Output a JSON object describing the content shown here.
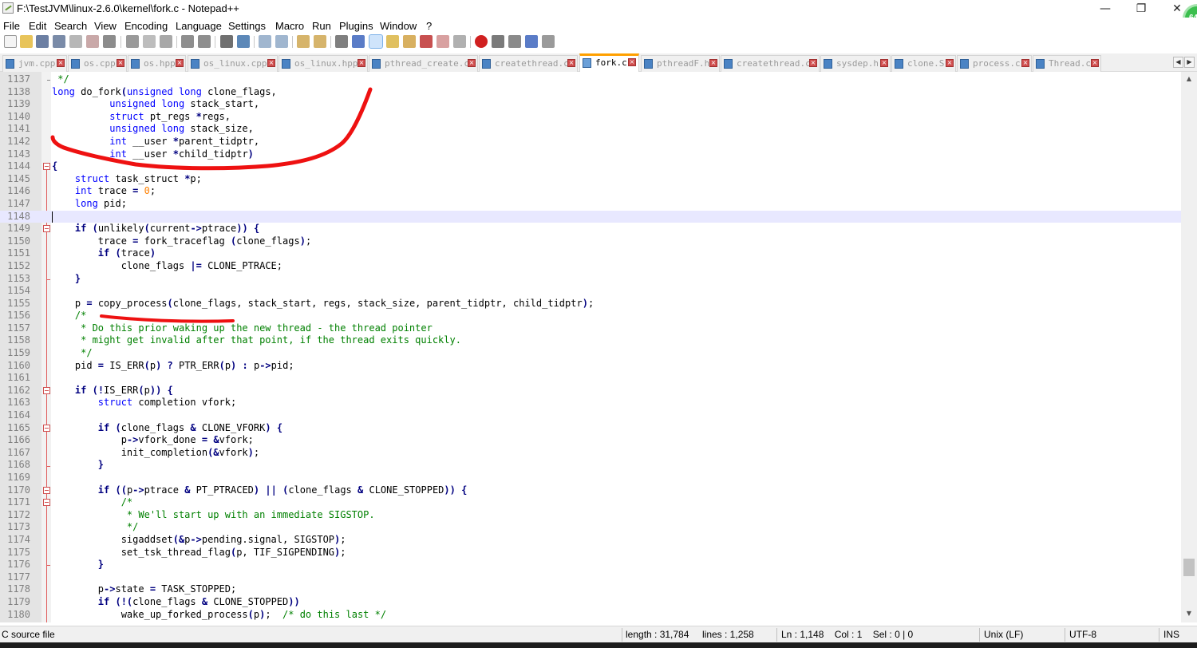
{
  "window": {
    "title": "F:\\TestJVM\\linux-2.6.0\\kernel\\fork.c - Notepad++",
    "minimize": "—",
    "maximize": "❐",
    "close": "✕",
    "badge": "64"
  },
  "menu": [
    "File",
    "Edit",
    "Search",
    "View",
    "Encoding",
    "Language",
    "Settings",
    "Macro",
    "Run",
    "Plugins",
    "Window",
    "?"
  ],
  "tabs": [
    {
      "label": "jvm.cpp",
      "active": false
    },
    {
      "label": "os.cpp",
      "active": false
    },
    {
      "label": "os.hpp",
      "active": false
    },
    {
      "label": "os_linux.cpp",
      "active": false
    },
    {
      "label": "os_linux.hpp",
      "active": false
    },
    {
      "label": "pthread_create.c",
      "active": false
    },
    {
      "label": "createthread.c",
      "active": false
    },
    {
      "label": "fork.c",
      "active": true
    },
    {
      "label": "pthreadF.h",
      "active": false
    },
    {
      "label": "createthread.c",
      "active": false
    },
    {
      "label": "sysdep.h",
      "active": false
    },
    {
      "label": "clone.S",
      "active": false
    },
    {
      "label": "process.c",
      "active": false
    },
    {
      "label": "Thread.c",
      "active": false
    }
  ],
  "editor": {
    "line_numbers": [
      "1137",
      "1138",
      "1139",
      "1140",
      "1141",
      "1142",
      "1143",
      "1144",
      "1145",
      "1146",
      "1147",
      "1148",
      "1149",
      "1150",
      "1151",
      "1152",
      "1153",
      "1154",
      "1155",
      "1156",
      "1157",
      "1158",
      "1159",
      "1160",
      "1161",
      "1162",
      "1163",
      "1164",
      "1165",
      "1166",
      "1167",
      "1168",
      "1169",
      "1170",
      "1171",
      "1172",
      "1173",
      "1174",
      "1175",
      "1176",
      "1177",
      "1178",
      "1179",
      "1180"
    ],
    "current_line": "1148",
    "code": [
      [
        [
          "cm",
          " */"
        ]
      ],
      [
        [
          "kw",
          "long"
        ],
        [
          "",
          " do_fork"
        ],
        [
          "op",
          "("
        ],
        [
          "kw",
          "unsigned long"
        ],
        [
          "",
          " clone_flags,"
        ]
      ],
      [
        [
          "",
          "          "
        ],
        [
          "kw",
          "unsigned long"
        ],
        [
          "",
          " stack_start,"
        ]
      ],
      [
        [
          "",
          "          "
        ],
        [
          "kw",
          "struct"
        ],
        [
          "",
          " pt_regs "
        ],
        [
          "op",
          "*"
        ],
        [
          "",
          "regs,"
        ]
      ],
      [
        [
          "",
          "          "
        ],
        [
          "kw",
          "unsigned long"
        ],
        [
          "",
          " stack_size,"
        ]
      ],
      [
        [
          "",
          "          "
        ],
        [
          "kw",
          "int"
        ],
        [
          "",
          " __user "
        ],
        [
          "op",
          "*"
        ],
        [
          "",
          "parent_tidptr,"
        ]
      ],
      [
        [
          "",
          "          "
        ],
        [
          "kw",
          "int"
        ],
        [
          "",
          " __user "
        ],
        [
          "op",
          "*"
        ],
        [
          "",
          "child_tidptr"
        ],
        [
          "op",
          ")"
        ]
      ],
      [
        [
          "op",
          "{"
        ]
      ],
      [
        [
          "",
          "    "
        ],
        [
          "kw",
          "struct"
        ],
        [
          "",
          " task_struct "
        ],
        [
          "op",
          "*"
        ],
        [
          "",
          "p;"
        ]
      ],
      [
        [
          "",
          "    "
        ],
        [
          "kw",
          "int"
        ],
        [
          "",
          " trace "
        ],
        [
          "op",
          "="
        ],
        [
          "",
          " "
        ],
        [
          "num",
          "0"
        ],
        [
          "",
          ";"
        ]
      ],
      [
        [
          "",
          "    "
        ],
        [
          "kw",
          "long"
        ],
        [
          "",
          " pid;"
        ]
      ],
      [
        [
          "",
          ""
        ]
      ],
      [
        [
          "",
          "    "
        ],
        [
          "op",
          "if"
        ],
        [
          "",
          " "
        ],
        [
          "op",
          "("
        ],
        [
          "",
          "unlikely"
        ],
        [
          "op",
          "("
        ],
        [
          "",
          "current"
        ],
        [
          "op",
          "->"
        ],
        [
          "",
          "ptrace"
        ],
        [
          "op",
          "))"
        ],
        [
          "",
          " "
        ],
        [
          "op",
          "{"
        ]
      ],
      [
        [
          "",
          "        trace "
        ],
        [
          "op",
          "="
        ],
        [
          "",
          " fork_traceflag "
        ],
        [
          "op",
          "("
        ],
        [
          "",
          "clone_flags"
        ],
        [
          "op",
          ")"
        ],
        [
          "",
          ";"
        ]
      ],
      [
        [
          "",
          "        "
        ],
        [
          "op",
          "if"
        ],
        [
          "",
          " "
        ],
        [
          "op",
          "("
        ],
        [
          "",
          "trace"
        ],
        [
          "op",
          ")"
        ]
      ],
      [
        [
          "",
          "            clone_flags "
        ],
        [
          "op",
          "|="
        ],
        [
          "",
          " CLONE_PTRACE;"
        ]
      ],
      [
        [
          "",
          "    "
        ],
        [
          "op",
          "}"
        ]
      ],
      [
        [
          "",
          ""
        ]
      ],
      [
        [
          "",
          "    p "
        ],
        [
          "op",
          "="
        ],
        [
          "",
          " copy_process"
        ],
        [
          "op",
          "("
        ],
        [
          "",
          "clone_flags, stack_start, regs, stack_size, parent_tidptr, child_tidptr"
        ],
        [
          "op",
          ")"
        ],
        [
          "",
          ";"
        ]
      ],
      [
        [
          "",
          "    "
        ],
        [
          "cm",
          "/*"
        ]
      ],
      [
        [
          "cm",
          "     * Do this prior waking up the new thread - the thread pointer"
        ]
      ],
      [
        [
          "cm",
          "     * might get invalid after that point, if the thread exits quickly."
        ]
      ],
      [
        [
          "cm",
          "     */"
        ]
      ],
      [
        [
          "",
          "    pid "
        ],
        [
          "op",
          "="
        ],
        [
          "",
          " IS_ERR"
        ],
        [
          "op",
          "("
        ],
        [
          "",
          "p"
        ],
        [
          "op",
          ")"
        ],
        [
          "",
          " "
        ],
        [
          "op",
          "?"
        ],
        [
          "",
          " PTR_ERR"
        ],
        [
          "op",
          "("
        ],
        [
          "",
          "p"
        ],
        [
          "op",
          ")"
        ],
        [
          "",
          " "
        ],
        [
          "op",
          ":"
        ],
        [
          "",
          " p"
        ],
        [
          "op",
          "->"
        ],
        [
          "",
          "pid;"
        ]
      ],
      [
        [
          "",
          ""
        ]
      ],
      [
        [
          "",
          "    "
        ],
        [
          "op",
          "if"
        ],
        [
          "",
          " "
        ],
        [
          "op",
          "(!"
        ],
        [
          "",
          "IS_ERR"
        ],
        [
          "op",
          "("
        ],
        [
          "",
          "p"
        ],
        [
          "op",
          "))"
        ],
        [
          "",
          " "
        ],
        [
          "op",
          "{"
        ]
      ],
      [
        [
          "",
          "        "
        ],
        [
          "kw",
          "struct"
        ],
        [
          "",
          " completion vfork;"
        ]
      ],
      [
        [
          "",
          ""
        ]
      ],
      [
        [
          "",
          "        "
        ],
        [
          "op",
          "if"
        ],
        [
          "",
          " "
        ],
        [
          "op",
          "("
        ],
        [
          "",
          "clone_flags "
        ],
        [
          "op",
          "&"
        ],
        [
          "",
          " CLONE_VFORK"
        ],
        [
          "op",
          ")"
        ],
        [
          "",
          " "
        ],
        [
          "op",
          "{"
        ]
      ],
      [
        [
          "",
          "            p"
        ],
        [
          "op",
          "->"
        ],
        [
          "",
          "vfork_done "
        ],
        [
          "op",
          "="
        ],
        [
          "",
          " "
        ],
        [
          "op",
          "&"
        ],
        [
          "",
          "vfork;"
        ]
      ],
      [
        [
          "",
          "            init_completion"
        ],
        [
          "op",
          "(&"
        ],
        [
          "",
          "vfork"
        ],
        [
          "op",
          ")"
        ],
        [
          "",
          ";"
        ]
      ],
      [
        [
          "",
          "        "
        ],
        [
          "op",
          "}"
        ]
      ],
      [
        [
          "",
          ""
        ]
      ],
      [
        [
          "",
          "        "
        ],
        [
          "op",
          "if"
        ],
        [
          "",
          " "
        ],
        [
          "op",
          "(("
        ],
        [
          "",
          "p"
        ],
        [
          "op",
          "->"
        ],
        [
          "",
          "ptrace "
        ],
        [
          "op",
          "&"
        ],
        [
          "",
          " PT_PTRACED"
        ],
        [
          "op",
          ")"
        ],
        [
          "",
          " "
        ],
        [
          "op",
          "||"
        ],
        [
          "",
          " "
        ],
        [
          "op",
          "("
        ],
        [
          "",
          "clone_flags "
        ],
        [
          "op",
          "&"
        ],
        [
          "",
          " CLONE_STOPPED"
        ],
        [
          "op",
          "))"
        ],
        [
          "",
          " "
        ],
        [
          "op",
          "{"
        ]
      ],
      [
        [
          "",
          "            "
        ],
        [
          "cm",
          "/*"
        ]
      ],
      [
        [
          "cm",
          "             * We'll start up with an immediate SIGSTOP."
        ]
      ],
      [
        [
          "cm",
          "             */"
        ]
      ],
      [
        [
          "",
          "            sigaddset"
        ],
        [
          "op",
          "(&"
        ],
        [
          "",
          "p"
        ],
        [
          "op",
          "->"
        ],
        [
          "",
          "pending.signal, SIGSTOP"
        ],
        [
          "op",
          ")"
        ],
        [
          "",
          ";"
        ]
      ],
      [
        [
          "",
          "            set_tsk_thread_flag"
        ],
        [
          "op",
          "("
        ],
        [
          "",
          "p, TIF_SIGPENDING"
        ],
        [
          "op",
          ")"
        ],
        [
          "",
          ";"
        ]
      ],
      [
        [
          "",
          "        "
        ],
        [
          "op",
          "}"
        ]
      ],
      [
        [
          "",
          ""
        ]
      ],
      [
        [
          "",
          "        p"
        ],
        [
          "op",
          "->"
        ],
        [
          "",
          "state "
        ],
        [
          "op",
          "="
        ],
        [
          "",
          " TASK_STOPPED;"
        ]
      ],
      [
        [
          "",
          "        "
        ],
        [
          "op",
          "if"
        ],
        [
          "",
          " "
        ],
        [
          "op",
          "(!("
        ],
        [
          "",
          "clone_flags "
        ],
        [
          "op",
          "&"
        ],
        [
          "",
          " CLONE_STOPPED"
        ],
        [
          "op",
          "))"
        ]
      ],
      [
        [
          "",
          "            wake_up_forked_process"
        ],
        [
          "op",
          "("
        ],
        [
          "",
          "p"
        ],
        [
          "op",
          ")"
        ],
        [
          "",
          ";  "
        ],
        [
          "cm",
          "/* do this last */"
        ]
      ]
    ]
  },
  "status": {
    "file_type": "C source file",
    "length": "length : 31,784",
    "lines": "lines : 1,258",
    "position": "Ln : 1,148    Col : 1    Sel : 0 | 0",
    "eol": "Unix (LF)",
    "encoding": "UTF-8",
    "mode": "INS"
  }
}
